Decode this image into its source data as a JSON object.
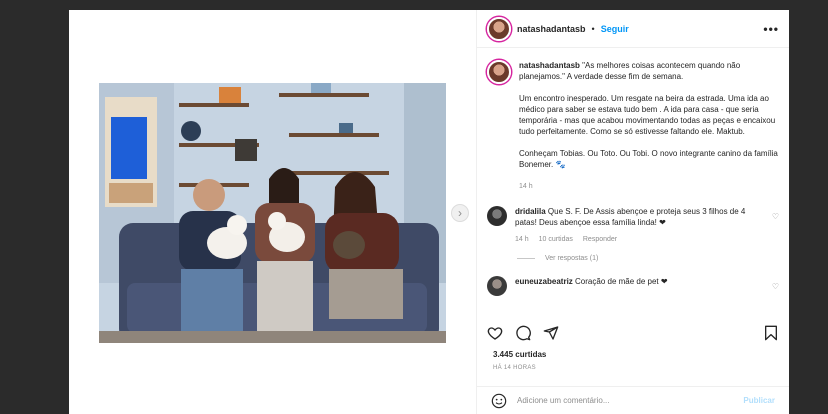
{
  "post": {
    "author": "natashadantasb",
    "separator": "•",
    "follow_label": "Seguir",
    "more_label": "•••"
  },
  "caption": {
    "author": "natashadantasb",
    "p1": "\"As melhores coisas acontecem quando não planejamos.\" A verdade desse fim de semana.",
    "p2": "Um encontro inesperado. Um resgate na beira da estrada. Uma ida ao médico para saber se estava tudo bem . A ida para casa - que seria temporária - mas que acabou movimentando todas as peças e encaixou tudo perfeitamente. Como se só estivesse faltando ele. Maktub.",
    "p3": "Conheçam Tobias. Ou Toto. Ou Tobi. O novo integrante canino da família Bonemer. 🐾",
    "time": "14 h"
  },
  "comments": [
    {
      "user": "dridalila",
      "text": "Que S. F. De Assis abençoe e proteja seus 3 filhos de 4 patas! Deus abençoe essa família linda! ❤",
      "time": "14 h",
      "likes": "10 curtidas",
      "reply": "Responder",
      "view_replies": "Ver respostas (1)"
    },
    {
      "user": "euneuzabeatriz",
      "text": "Coração de mãe de pet ❤"
    }
  ],
  "likes_count": "3.445 curtidas",
  "posted_ago": "HÁ 14 HORAS",
  "add_comment": {
    "placeholder": "Adicione um comentário...",
    "publish_label": "Publicar"
  },
  "colors": {
    "accent": "#0095f6",
    "heart": "#ed4956",
    "publish_disabled": "#b2dffc"
  }
}
